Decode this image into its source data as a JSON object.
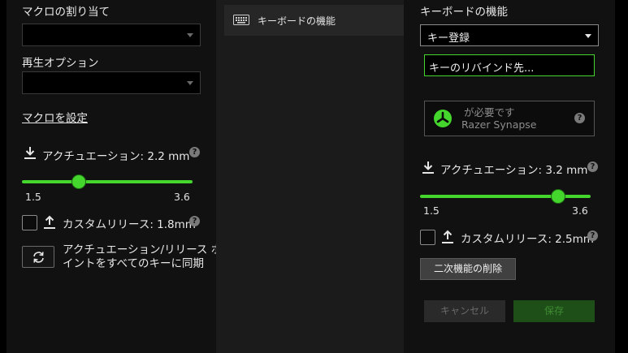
{
  "left": {
    "macro_assign_label": "マクロの割り当て",
    "playback_option_label": "再生オプション",
    "macro_settings_link": "マクロを設定",
    "actuation_label": "アクチュエーション: 2.2 mm",
    "slider": {
      "min": "1.5",
      "max": "3.6",
      "value": 2.2,
      "range": [
        1.5,
        3.6
      ]
    },
    "custom_release_label": "カスタムリリース: 1.8mm",
    "sync_label_line1": "アクチュエーション/リリース ポ",
    "sync_label_line2": "イントをすべてのキーに同期"
  },
  "middle": {
    "menu_item_label": "キーボードの機能"
  },
  "right": {
    "section_title": "キーボードの機能",
    "key_register_value": "キー登録",
    "rebind_placeholder": "キーのリバインド先...",
    "synapse_line1": "が必要です",
    "synapse_line2": "Razer Synapse",
    "actuation_label": "アクチュエーション: 3.2 mm",
    "slider": {
      "min": "1.5",
      "max": "3.6",
      "value": 3.2,
      "range": [
        1.5,
        3.6
      ]
    },
    "custom_release_label": "カスタムリリース: 2.5mm",
    "remove_secondary_button": "二次機能の削除",
    "cancel_button": "キャンセル",
    "save_button": "保存"
  },
  "icons": {
    "help": "?"
  },
  "colors": {
    "accent": "#44d62c",
    "save_bg": "#1e4f18",
    "panel_bg": "#111111"
  }
}
